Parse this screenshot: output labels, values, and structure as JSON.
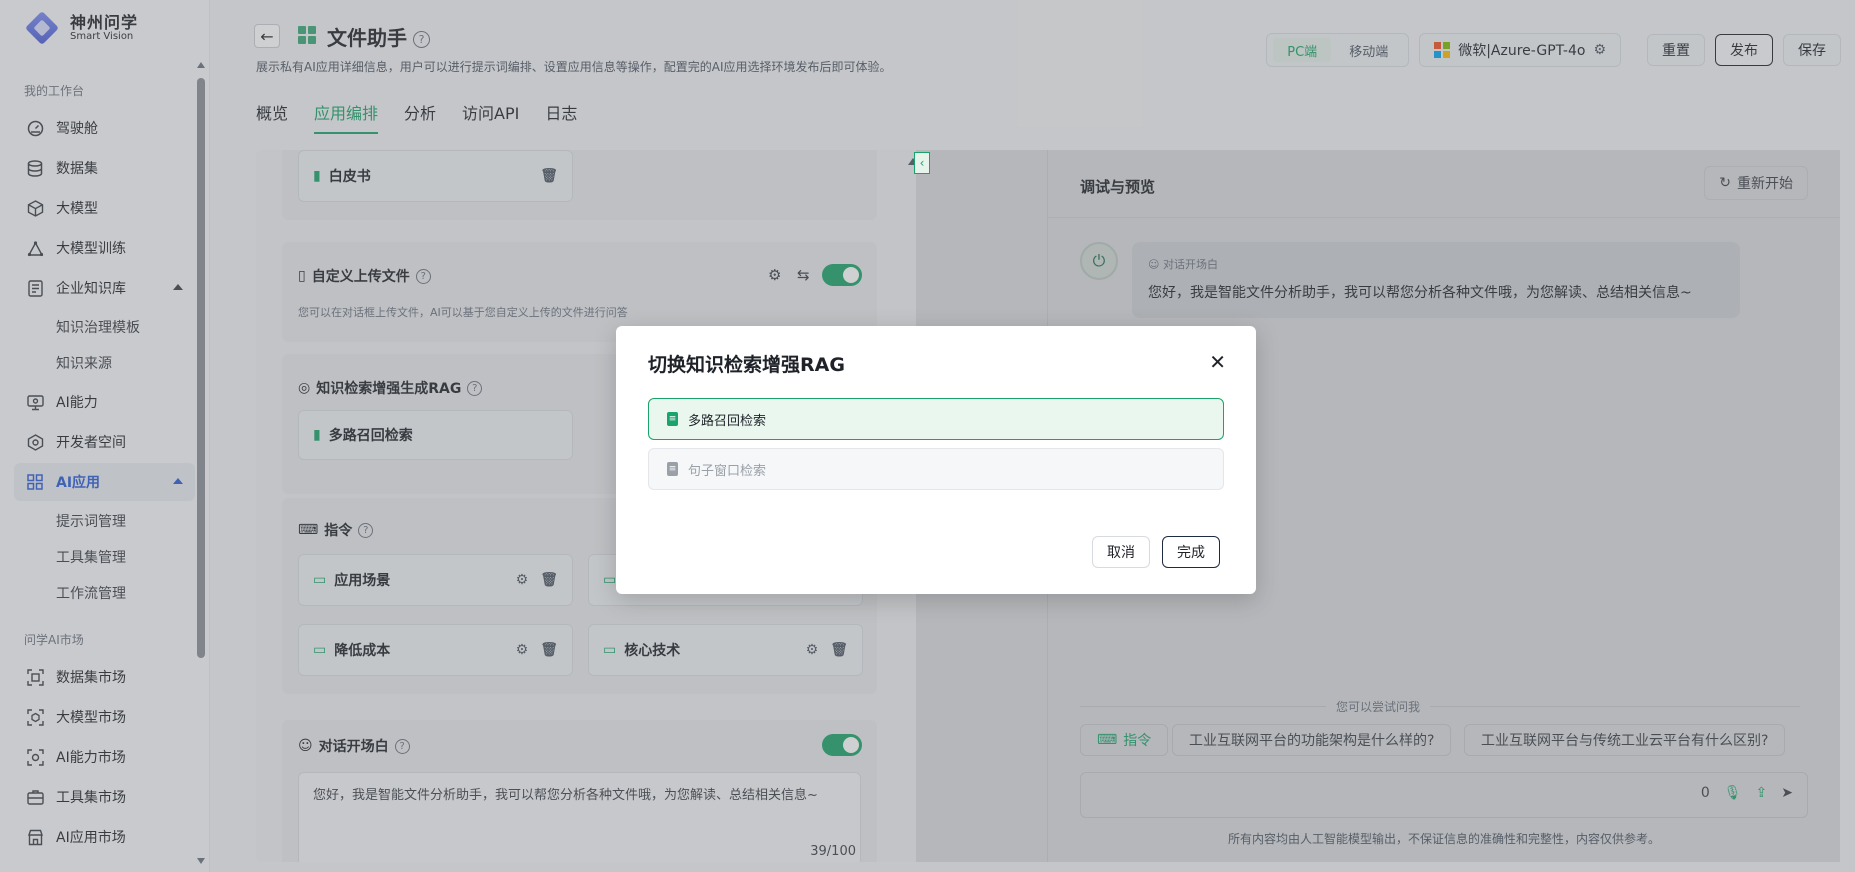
{
  "brand": {
    "name_cn": "神州问学",
    "name_en": "Smart Vision"
  },
  "sidebar": {
    "section_workspace": "我的工作台",
    "items": [
      {
        "label": "驾驶舱",
        "icon": "dashboard-icon"
      },
      {
        "label": "数据集",
        "icon": "database-icon"
      },
      {
        "label": "大模型",
        "icon": "cube-icon"
      },
      {
        "label": "大模型训练",
        "icon": "training-icon"
      },
      {
        "label": "企业知识库",
        "icon": "knowledge-icon"
      },
      {
        "label": "AI能力",
        "icon": "ai-capability-icon"
      },
      {
        "label": "开发者空间",
        "icon": "developer-icon"
      },
      {
        "label": "AI应用",
        "icon": "apps-grid-icon"
      }
    ],
    "knowledge_sub": [
      "知识治理模板",
      "知识来源"
    ],
    "apps_sub": [
      "提示词管理",
      "工具集管理",
      "工作流管理"
    ],
    "section_market": "问学AI市场",
    "market": [
      {
        "label": "数据集市场",
        "icon": "dataset-market-icon"
      },
      {
        "label": "大模型市场",
        "icon": "model-market-icon"
      },
      {
        "label": "AI能力市场",
        "icon": "capability-market-icon"
      },
      {
        "label": "工具集市场",
        "icon": "toolkit-market-icon"
      },
      {
        "label": "AI应用市场",
        "icon": "app-market-icon"
      }
    ]
  },
  "header": {
    "title": "文件助手",
    "desc": "展示私有AI应用详细信息，用户可以进行提示词编排、设置应用信息等操作，配置完的AI应用选择环境发布后即可体验。",
    "tabs": [
      "概览",
      "应用编排",
      "分析",
      "访问API",
      "日志"
    ],
    "active_tab": "应用编排",
    "platform": {
      "pc": "PC端",
      "mobile": "移动端"
    },
    "model": "微软|Azure-GPT-4o",
    "reset": "重置",
    "publish": "发布",
    "save": "保存"
  },
  "editor": {
    "whitepaper": "白皮书",
    "custom_upload": {
      "title": "自定义上传文件",
      "desc": "您可以在对话框上传文件，AI可以基于您自定义上传的文件进行问答",
      "enabled": true
    },
    "rag": {
      "title": "知识检索增强生成RAG",
      "selected": "多路召回检索"
    },
    "commands": {
      "title": "指令",
      "items": [
        "应用场景",
        "降低成本",
        "核心技术"
      ]
    },
    "opening": {
      "title": "对话开场白",
      "enabled": true,
      "text": "您好，我是智能文件分析助手，我可以帮您分析各种文件哦，为您解读、总结相关信息~",
      "counter": "39/100"
    }
  },
  "preview": {
    "title": "调试与预览",
    "restart": "重新开始",
    "opening_label": "对话开场白",
    "opening_msg": "您好，我是智能文件分析助手，我可以帮您分析各种文件哦，为您解读、总结相关信息~",
    "try_label": "您可以尝试问我",
    "cmd_chip": "指令",
    "suggestions": [
      "工业互联网平台的功能架构是什么样的?",
      "工业互联网平台与传统工业云平台有什么区别?"
    ],
    "char_count": "0",
    "disclaimer": "所有内容均由人工智能模型输出，不保证信息的准确性和完整性，内容仅供参考。"
  },
  "modal": {
    "title": "切换知识检索增强RAG",
    "options": [
      {
        "label": "多路召回检索",
        "selected": true
      },
      {
        "label": "句子窗口检索",
        "selected": false
      }
    ],
    "cancel": "取消",
    "ok": "完成"
  },
  "colors": {
    "accent": "#1aa36b",
    "active_nav": "#2a5bd7"
  }
}
